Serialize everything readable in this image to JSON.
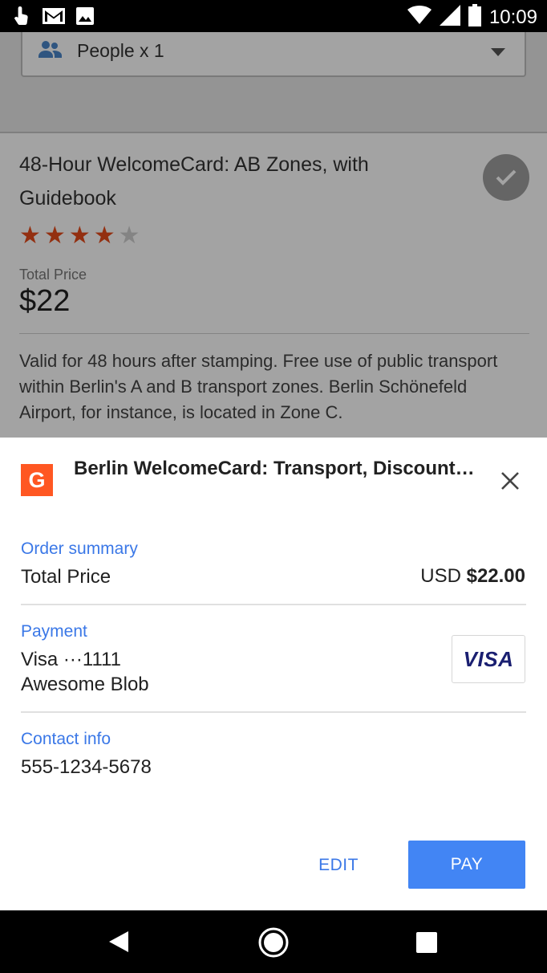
{
  "status_bar": {
    "time": "10:09",
    "left_icons": [
      "touch-icon",
      "gmail-icon",
      "image-icon"
    ],
    "right_icons": [
      "wifi-icon",
      "signal-icon",
      "battery-icon"
    ]
  },
  "background_page": {
    "people_select_value": "People x 1",
    "card_title": "48-Hour WelcomeCard: AB Zones, with Guidebook",
    "rating": {
      "value": 4,
      "max": 5
    },
    "total_price_label": "Total Price",
    "total_price_value": "$22",
    "description": "Valid for 48 hours after stamping. Free use of public transport within Berlin's A and B transport zones. Berlin Schönefeld Airport, for instance, is located in Zone C."
  },
  "payment_sheet": {
    "logo_letter": "G",
    "title": "Berlin WelcomeCard: Transport, Discounts, Guide Book",
    "order_summary_label": "Order summary",
    "total_price_label": "Total Price",
    "currency": "USD",
    "amount": "$22.00",
    "payment_label": "Payment",
    "card_number": "Visa ···1111",
    "card_holder": "Awesome Blob",
    "card_brand": "VISA",
    "contact_label": "Contact info",
    "contact_phone": "555-1234-5678",
    "edit_label": "EDIT",
    "pay_label": "PAY"
  },
  "colors": {
    "accent": "#4285f4",
    "link": "#3b78e7",
    "star": "#e64a19",
    "logo": "#ff5722",
    "visa": "#1a1f71"
  }
}
